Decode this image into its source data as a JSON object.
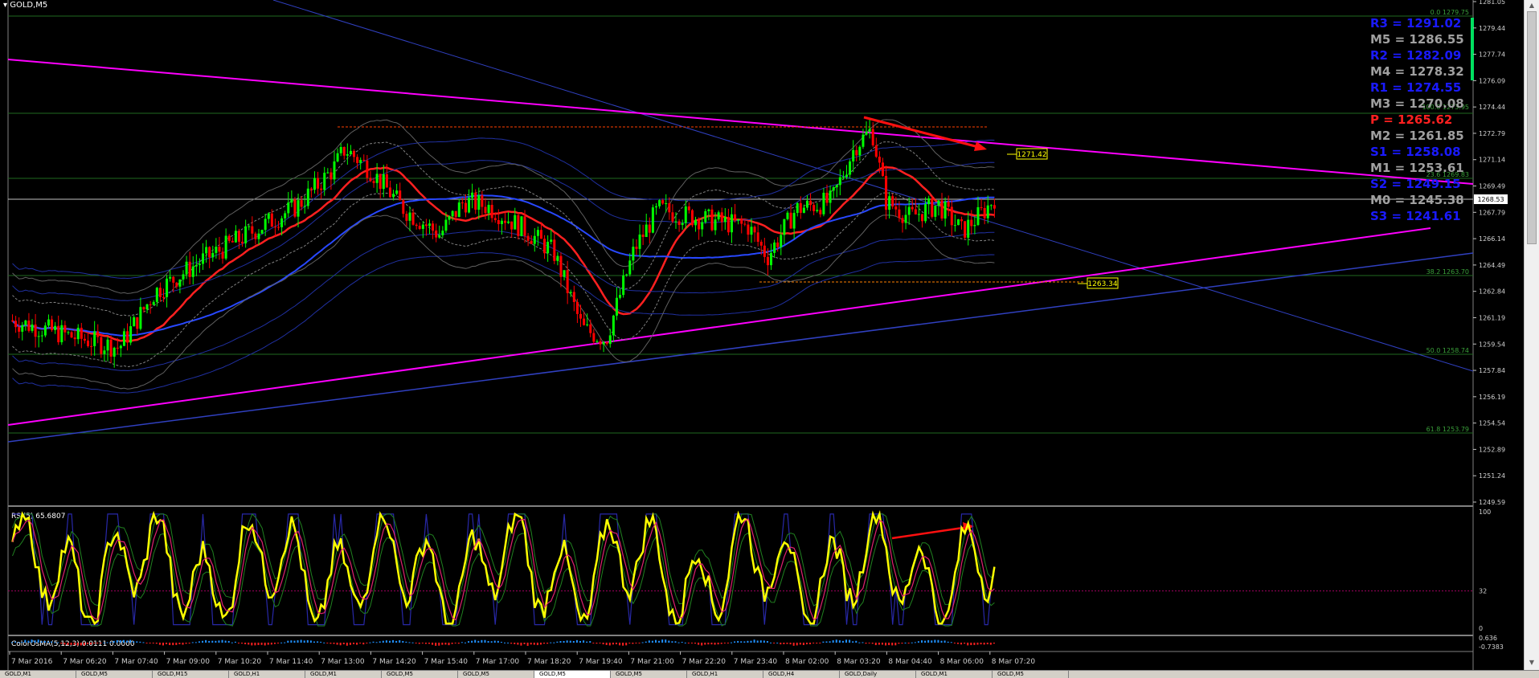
{
  "chart": {
    "symbol": "GOLD,M5",
    "rsi_label": "RSI(5) 65.6807",
    "osma_label": "ColorOsMA(5,12,3) 0.0111 0.0000",
    "current_price": "1268.53",
    "price_tag_1": "1271.42",
    "price_tag_2": "1263.34"
  },
  "price_axis": [
    "1281.05",
    "1279.44",
    "1277.74",
    "1276.09",
    "1274.44",
    "1272.79",
    "1271.14",
    "1269.49",
    "1267.79",
    "1266.14",
    "1264.49",
    "1262.84",
    "1261.19",
    "1259.54",
    "1257.84",
    "1256.19",
    "1254.54",
    "1252.89",
    "1251.24",
    "1249.59"
  ],
  "rsi_axis": [
    "100",
    "32",
    "0"
  ],
  "osma_axis": [
    "0.636",
    "-0.7383"
  ],
  "time_axis": [
    "7 Mar 2016",
    "7 Mar 06:20",
    "7 Mar 07:40",
    "7 Mar 09:00",
    "7 Mar 10:20",
    "7 Mar 11:40",
    "7 Mar 13:00",
    "7 Mar 14:20",
    "7 Mar 15:40",
    "7 Mar 17:00",
    "7 Mar 18:20",
    "7 Mar 19:40",
    "7 Mar 21:00",
    "7 Mar 22:20",
    "7 Mar 23:40",
    "8 Mar 02:00",
    "8 Mar 03:20",
    "8 Mar 04:40",
    "8 Mar 06:00",
    "8 Mar 07:20"
  ],
  "fib_labels": [
    "0.0 1279.75",
    "23.6 1269.83",
    "38.2 1263.70",
    "50.0 1258.74",
    "61.8 1253.79",
    "100.0 1273.95"
  ],
  "pivots": [
    {
      "text": "R3 = 1291.02",
      "color": "#1a1aff"
    },
    {
      "text": "M5 = 1286.55",
      "color": "#a0a0a0"
    },
    {
      "text": "R2 = 1282.09",
      "color": "#1a1aff"
    },
    {
      "text": "M4 = 1278.32",
      "color": "#a0a0a0"
    },
    {
      "text": "R1 = 1274.55",
      "color": "#1a1aff"
    },
    {
      "text": "M3 = 1270.08",
      "color": "#a0a0a0"
    },
    {
      "text": "P  = 1265.62",
      "color": "#ff2020"
    },
    {
      "text": "M2 = 1261.85",
      "color": "#a0a0a0"
    },
    {
      "text": "S1 = 1258.08",
      "color": "#1a1aff"
    },
    {
      "text": "M1 = 1253.61",
      "color": "#a0a0a0"
    },
    {
      "text": "S2 = 1249.15",
      "color": "#1a1aff"
    },
    {
      "text": "M0 = 1245.38",
      "color": "#a0a0a0"
    },
    {
      "text": "S3 = 1241.61",
      "color": "#1a1aff"
    }
  ],
  "tabs": [
    "GOLD,M1",
    "GOLD,M5",
    "GOLD,M15",
    "GOLD,H1",
    "GOLD,M1",
    "GOLD,M5",
    "GOLD,M5",
    "GOLD,M5",
    "GOLD,M5",
    "GOLD,H1",
    "GOLD,H4",
    "GOLD,Daily",
    "GOLD,M1",
    "GOLD,M5"
  ],
  "active_tab_index": 7,
  "colors": {
    "bull": "#00ff00",
    "bear": "#ff0000",
    "magenta": "#ff00ff",
    "blue": "#2040ff",
    "rsi": "#ffff00",
    "grid": "#004000"
  }
}
